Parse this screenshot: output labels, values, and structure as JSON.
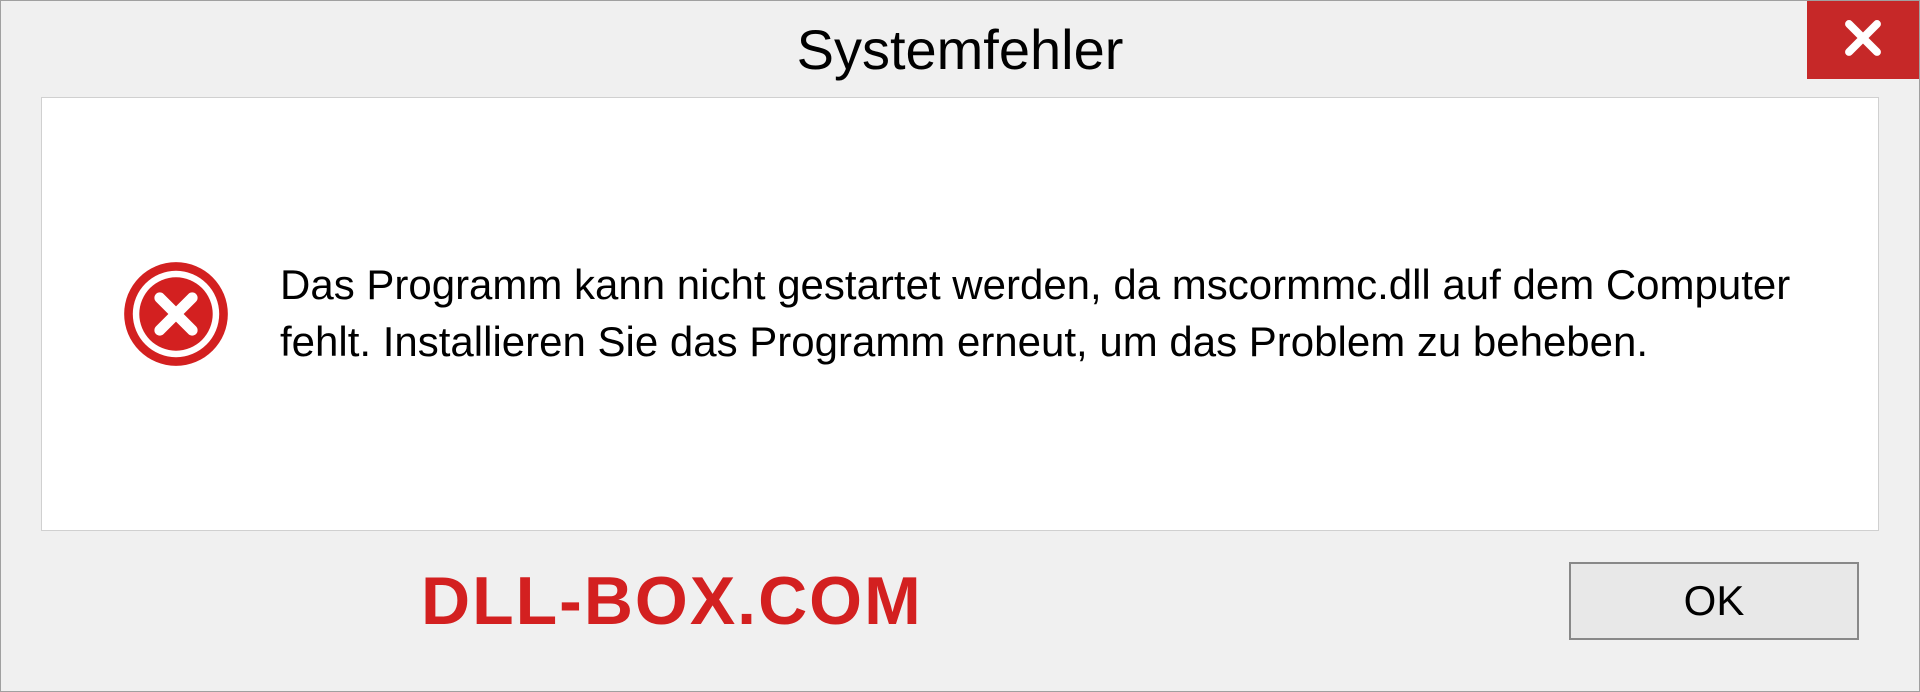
{
  "dialog": {
    "title": "Systemfehler",
    "message": "Das Programm kann nicht gestartet werden, da mscormmc.dll auf dem Computer fehlt. Installieren Sie das Programm erneut, um das Problem zu beheben.",
    "ok_label": "OK"
  },
  "watermark": "DLL-BOX.COM"
}
